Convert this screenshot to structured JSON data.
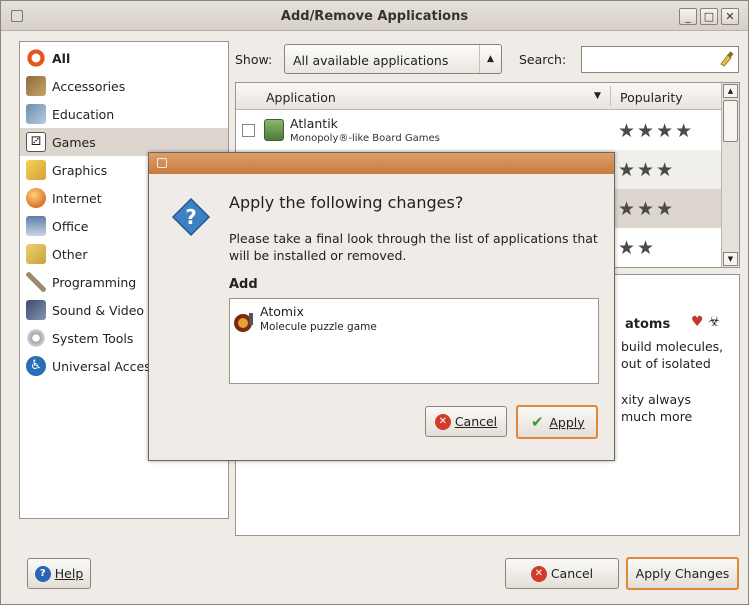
{
  "window": {
    "title": "Add/Remove Applications"
  },
  "sidebar": {
    "items": [
      {
        "label": "All",
        "icon": "ubuntu-logo-icon",
        "color": "#e5551f"
      },
      {
        "label": "Accessories",
        "icon": "accessories-icon",
        "color": "#8c6b3e"
      },
      {
        "label": "Education",
        "icon": "education-icon",
        "color": "#6a8fb0"
      },
      {
        "label": "Games",
        "icon": "games-icon",
        "color": "#3d3d3d"
      },
      {
        "label": "Graphics",
        "icon": "graphics-icon",
        "color": "#d8a032"
      },
      {
        "label": "Internet",
        "icon": "internet-icon",
        "color": "#e0813a"
      },
      {
        "label": "Office",
        "icon": "office-icon",
        "color": "#5d7ea8"
      },
      {
        "label": "Other",
        "icon": "other-icon",
        "color": "#c8a23a"
      },
      {
        "label": "Programming",
        "icon": "programming-icon",
        "color": "#9a8a6c"
      },
      {
        "label": "Sound & Video",
        "icon": "sound-video-icon",
        "color": "#3b4a6b"
      },
      {
        "label": "System Tools",
        "icon": "system-tools-icon",
        "color": "#a5a5a5"
      },
      {
        "label": "Universal Access",
        "icon": "universal-access-icon",
        "color": "#2a6fb5"
      }
    ],
    "selected": "Games"
  },
  "filter": {
    "show_label": "Show:",
    "show_value": "All available applications",
    "search_label": "Search:",
    "search_value": ""
  },
  "table": {
    "col_app": "Application",
    "col_pop": "Popularity",
    "rows": [
      {
        "name": "Atlantik",
        "desc": "Monopoly®-like Board Games",
        "stars": "★★★★"
      },
      {
        "name": "",
        "desc": "",
        "stars": "★★★"
      },
      {
        "name": "",
        "desc": "",
        "stars": "★★★"
      },
      {
        "name": "",
        "desc": "",
        "stars": "★★"
      }
    ]
  },
  "description": {
    "heading": "atoms",
    "lines": [
      "build molecules,",
      "out of isolated",
      "xity always",
      "much more"
    ]
  },
  "buttons": {
    "help": "Help",
    "cancel": "Cancel",
    "apply_changes": "Apply Changes"
  },
  "dialog": {
    "heading": "Apply the following changes?",
    "message": "Please take a final look through the list of applications that will be installed or removed.",
    "section": "Add",
    "items": [
      {
        "name": "Atomix",
        "desc": "Molecule puzzle game"
      }
    ],
    "cancel": "Cancel",
    "apply": "Apply",
    "title_color": "#cf8647"
  }
}
